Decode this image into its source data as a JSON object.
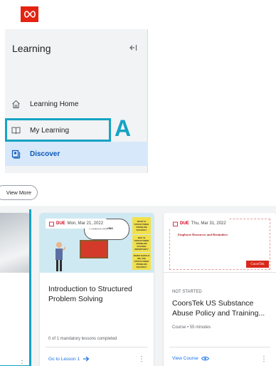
{
  "brand": {
    "logo_icon": "coorstek-infinity-logo",
    "logo_color": "#e42312"
  },
  "sidebar": {
    "title": "Learning",
    "collapse_icon": "collapse-left-icon",
    "items": [
      {
        "label": "Learning Home",
        "icon": "home-icon"
      },
      {
        "label": "My Learning",
        "icon": "book-icon"
      },
      {
        "label": "Discover",
        "icon": "discover-icon",
        "active": true
      }
    ]
  },
  "annotation": {
    "label": "A",
    "color": "#16a3c4"
  },
  "view_more_label": "View More",
  "cards": [
    {
      "due_label": "DUE",
      "due_date": "Mon, Mar 21, 2022",
      "title": "Introduction to Structured Problem Solving",
      "progress_text": "0 of 1 mandatory lessons completed",
      "action_label": "Go to Lesson 1",
      "action_icon": "arrow-right-icon",
      "thumb_header": "PROBLEM SOLVING",
      "stickies": [
        "WHAT IS STRUCTURED PROBLEM SOLVING?",
        "WHY IS STRUCTURED PROBLEM SOLVING IMPORTANT?",
        "WHEN SHOULD WE USE STRUCTURED PROBLEM SOLVING?"
      ]
    },
    {
      "due_label": "DUE",
      "due_date": "Thu, Mar 31, 2022",
      "status": "NOT STARTED",
      "title": "CoorsTek US Substance Abuse Policy and Training...",
      "meta": "Course • 55 minutes",
      "action_label": "View Course",
      "action_icon": "eye-icon",
      "thumb_heading": "Employee Resources and Reminders",
      "thumb_logo": "CoorsTek"
    }
  ]
}
